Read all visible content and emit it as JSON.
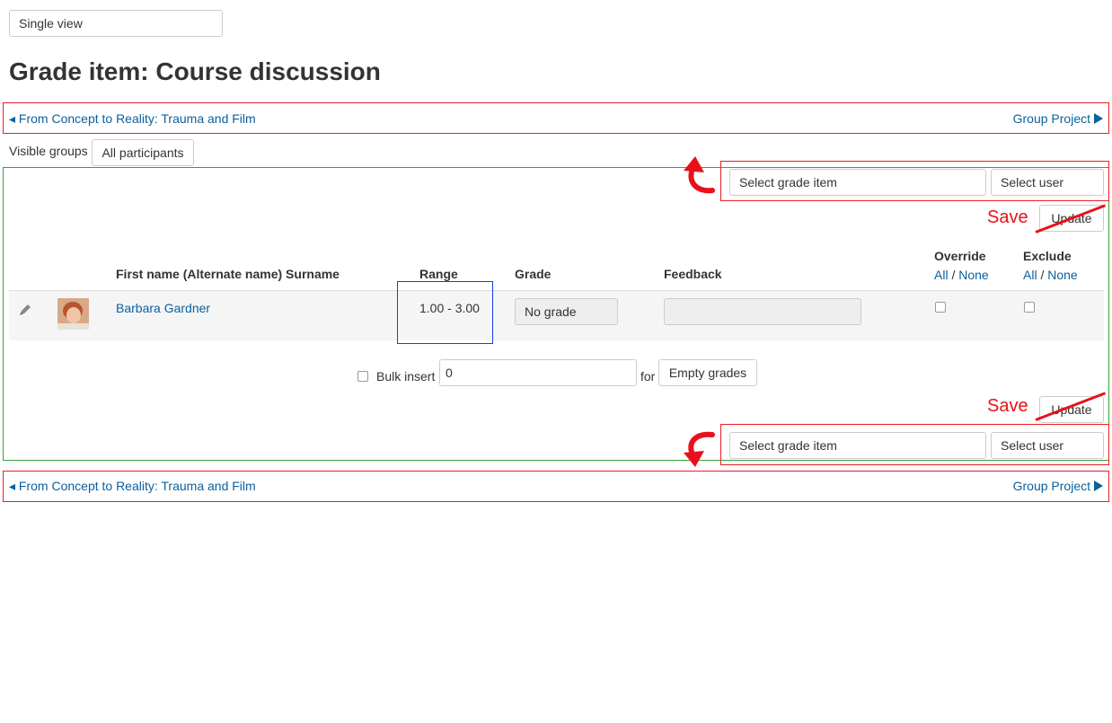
{
  "view_selector": {
    "value": "Single view"
  },
  "page_title": "Grade item: Course discussion",
  "nav_top": {
    "prev": "◂ From Concept to Reality: Trauma and Film",
    "next": "Group Project"
  },
  "nav_bottom": {
    "prev": "◂ From Concept to Reality: Trauma and Film",
    "next": "Group Project"
  },
  "groups": {
    "label": "Visible groups",
    "selected": "All participants"
  },
  "selectors": {
    "grade_item": "Select grade item",
    "user": "Select user"
  },
  "annotations": {
    "save_label": "Save",
    "update_label": "Update"
  },
  "table": {
    "headers": {
      "name": "First name (Alternate name) Surname",
      "range": "Range",
      "grade": "Grade",
      "feedback": "Feedback",
      "override": "Override",
      "exclude": "Exclude"
    },
    "links": {
      "all": "All",
      "sep": "/",
      "none": "None"
    },
    "rows": [
      {
        "name": "Barbara Gardner",
        "range": "1.00 - 3.00",
        "grade": "No grade",
        "feedback": ""
      }
    ]
  },
  "bulk_insert": {
    "label": "Bulk insert",
    "value": "0",
    "for_label": "for",
    "option": "Empty grades"
  },
  "colors": {
    "annotation_red": "#ee1c25",
    "frame_green": "#35a335",
    "highlight_blue": "#1a3ce6",
    "link_blue": "#0a5f9e"
  },
  "icons": [
    "pencil-icon",
    "user-avatar",
    "triangle-right-icon",
    "curved-arrow-icon"
  ]
}
